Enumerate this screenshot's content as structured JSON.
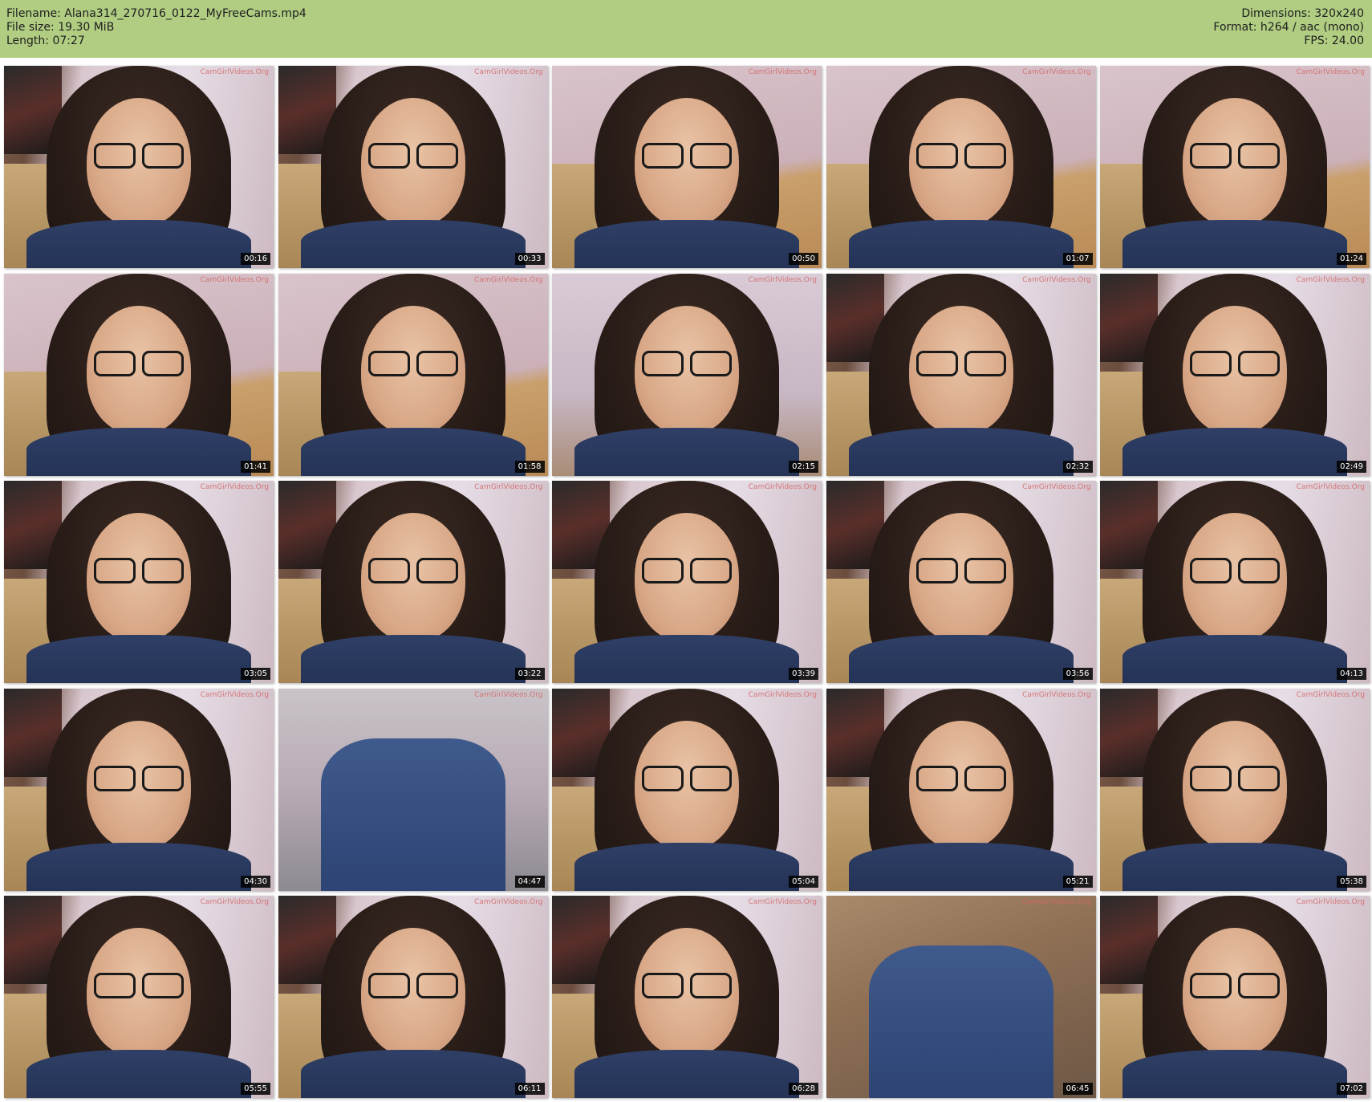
{
  "header": {
    "filename_line": "Filename: Alana314_270716_0122_MyFreeCams.mp4",
    "filesize_line": "File size: 19.30 MiB",
    "length_line": "Length: 07:27",
    "dimensions_line": "Dimensions: 320x240",
    "format_line": "Format: h264 / aac (mono)",
    "fps_line": "FPS: 24.00",
    "background_color": "#b0cd82"
  },
  "watermark": "CamGirlVideos.Org",
  "thumbnails": [
    {
      "timestamp": "00:16",
      "scene": "a"
    },
    {
      "timestamp": "00:33",
      "scene": "a"
    },
    {
      "timestamp": "00:50",
      "scene": "b"
    },
    {
      "timestamp": "01:07",
      "scene": "b"
    },
    {
      "timestamp": "01:24",
      "scene": "b"
    },
    {
      "timestamp": "01:41",
      "scene": "b"
    },
    {
      "timestamp": "01:58",
      "scene": "b"
    },
    {
      "timestamp": "02:15",
      "scene": "c"
    },
    {
      "timestamp": "02:32",
      "scene": "a"
    },
    {
      "timestamp": "02:49",
      "scene": "a"
    },
    {
      "timestamp": "03:05",
      "scene": "a"
    },
    {
      "timestamp": "03:22",
      "scene": "a"
    },
    {
      "timestamp": "03:39",
      "scene": "a"
    },
    {
      "timestamp": "03:56",
      "scene": "a"
    },
    {
      "timestamp": "04:13",
      "scene": "a"
    },
    {
      "timestamp": "04:30",
      "scene": "a"
    },
    {
      "timestamp": "04:47",
      "scene": "d"
    },
    {
      "timestamp": "05:04",
      "scene": "a"
    },
    {
      "timestamp": "05:21",
      "scene": "a"
    },
    {
      "timestamp": "05:38",
      "scene": "a"
    },
    {
      "timestamp": "05:55",
      "scene": "a"
    },
    {
      "timestamp": "06:11",
      "scene": "a"
    },
    {
      "timestamp": "06:28",
      "scene": "a"
    },
    {
      "timestamp": "06:45",
      "scene": "e"
    },
    {
      "timestamp": "07:02",
      "scene": "a"
    }
  ]
}
